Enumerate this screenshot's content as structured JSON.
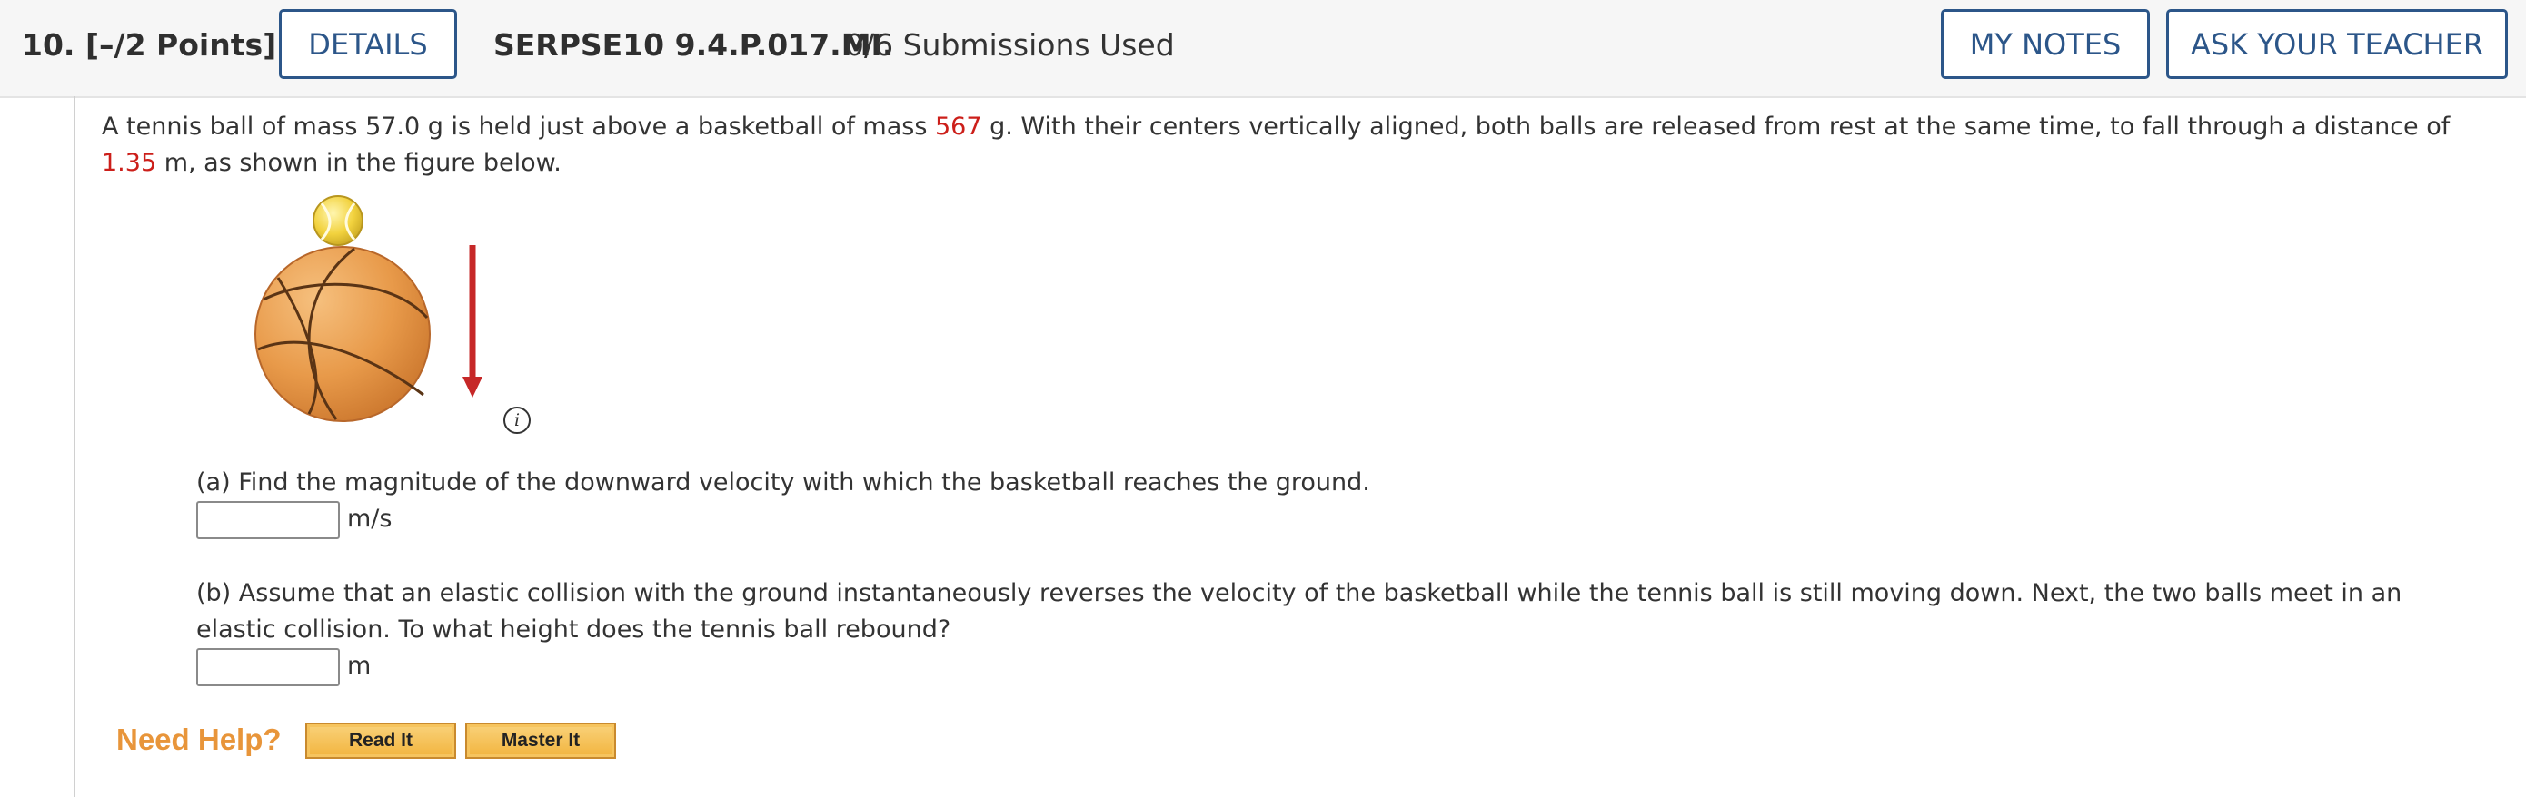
{
  "header": {
    "question_number": "10.",
    "points": "[–/2 Points]",
    "details_label": "DETAILS",
    "problem_code": "SERPSE10 9.4.P.017.MI.",
    "submissions": "0/6 Submissions Used",
    "my_notes_label": "MY NOTES",
    "ask_teacher_label": "ASK YOUR TEACHER"
  },
  "problem": {
    "text_1": "A tennis ball of mass 57.0 g is held just above a basketball of mass ",
    "basketball_mass": "567",
    "text_2": " g. With their centers vertically aligned, both balls are released from rest at the same time, to fall through a distance of ",
    "distance": "1.35",
    "text_3": " m, as shown in the figure below."
  },
  "figure": {
    "info_icon": "info-icon",
    "info_glyph": "i",
    "tennis_color": "#f2d23e",
    "basketball_color": "#e89a4a",
    "arrow_color": "#c62828"
  },
  "part_a": {
    "question": "(a) Find the magnitude of the downward velocity with which the basketball reaches the ground.",
    "value": "",
    "unit": "m/s"
  },
  "part_b": {
    "question": "(b) Assume that an elastic collision with the ground instantaneously reverses the velocity of the basketball while the tennis ball is still moving down. Next, the two balls meet in an elastic collision. To what height does the tennis ball rebound?",
    "value": "",
    "unit": "m"
  },
  "help": {
    "label": "Need Help?",
    "read_it": "Read It",
    "master_it": "Master It"
  },
  "colors": {
    "accent_blue": "#2c5689",
    "highlight_red": "#cc1f1a",
    "help_orange": "#e8953a"
  }
}
